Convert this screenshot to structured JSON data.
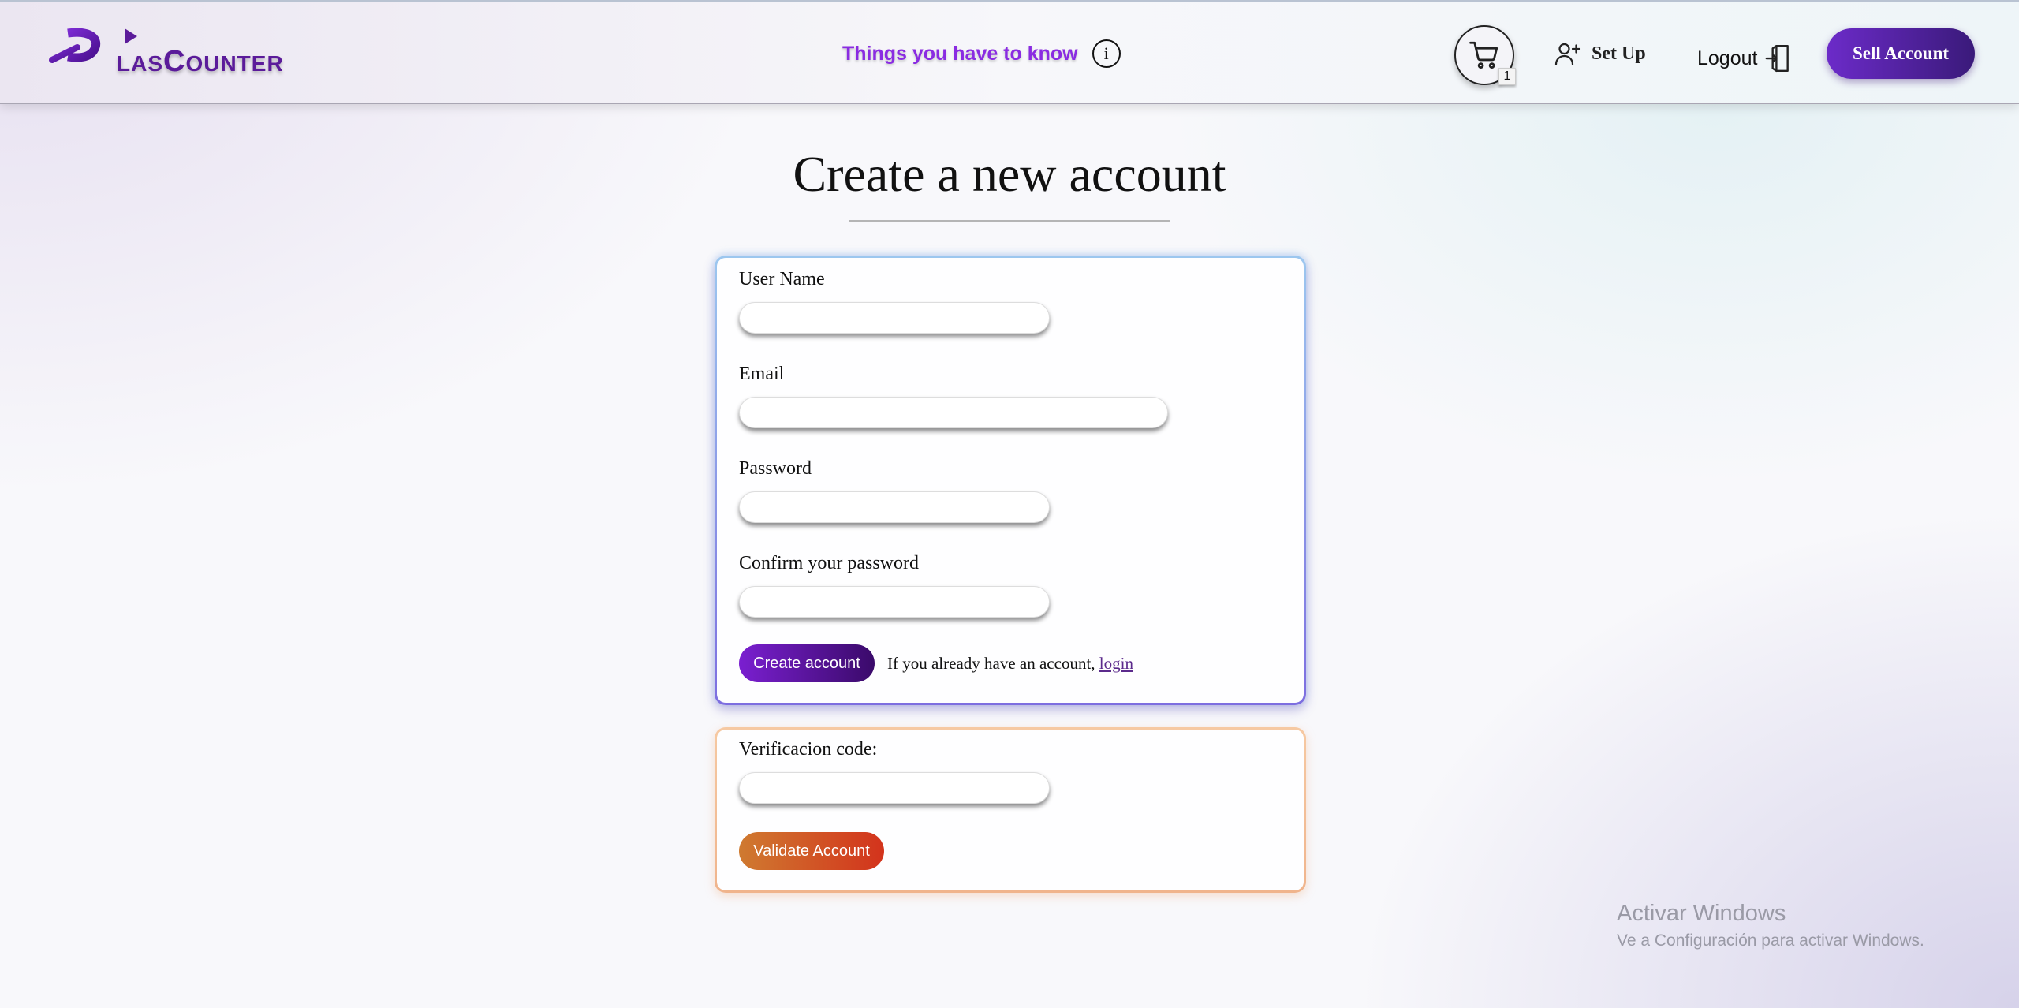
{
  "header": {
    "logo": {
      "initial": "P",
      "letters_small": "LAS",
      "big_c": "C",
      "letters_rest": "OUNTER"
    },
    "info_link": "Things you have to know",
    "info_icon": "i",
    "cart_count": "1",
    "setup_label": "Set Up",
    "logout_label": "Logout",
    "sell_button": "Sell Account"
  },
  "main": {
    "title": "Create a new account",
    "register_form": {
      "username_label": "User Name",
      "email_label": "Email",
      "password_label": "Password",
      "confirm_label": "Confirm your password",
      "username_value": "",
      "email_value": "",
      "password_value": "",
      "confirm_value": "",
      "create_button": "Create account",
      "login_prompt": "If you already have an account, ",
      "login_link": "login"
    },
    "verify_form": {
      "code_label": "Verificacion code:",
      "code_value": "",
      "validate_button": "Validate Account"
    }
  },
  "watermark": {
    "line1": "Activar Windows",
    "line2": "Ve a Configuración para activar Windows."
  },
  "colors": {
    "brand_purple": "#5b1b9a",
    "accent_purple": "#8a2be2",
    "validate_orange": "#cf7a30",
    "validate_red": "#d3331c"
  },
  "icons": [
    "info-icon",
    "cart-icon",
    "user-plus-icon",
    "logout-door-icon"
  ]
}
